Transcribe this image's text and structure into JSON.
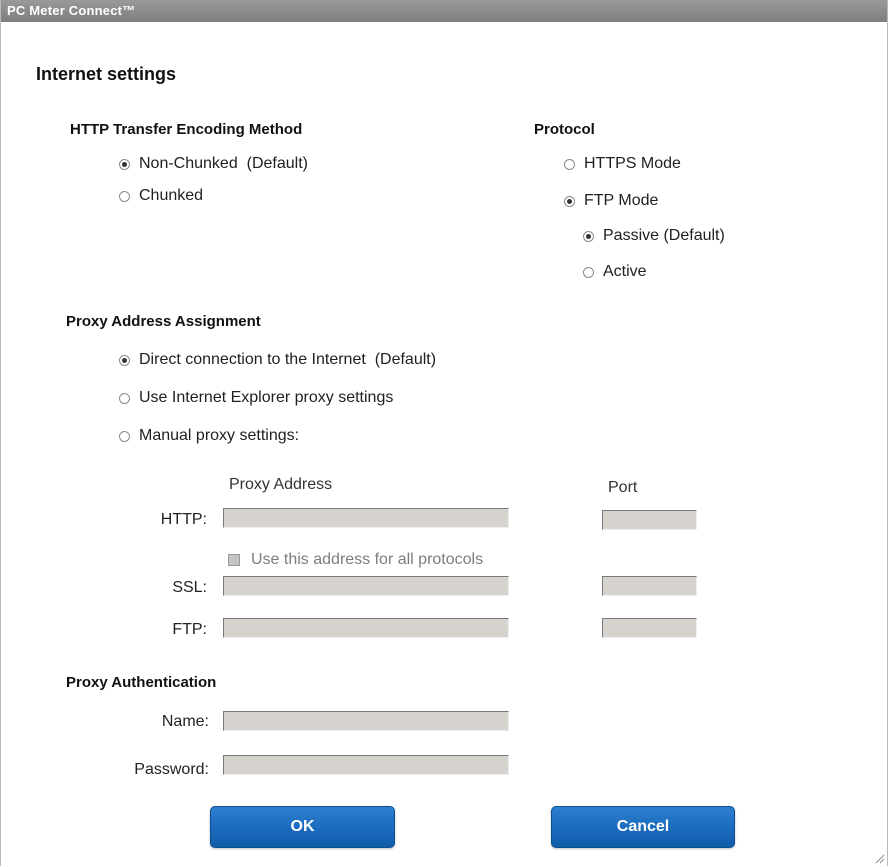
{
  "window": {
    "title": "PC Meter Connect™"
  },
  "page_title": "Internet settings",
  "encoding": {
    "heading": "HTTP Transfer Encoding Method",
    "options": [
      {
        "label": "Non-Chunked  (Default)",
        "checked": true
      },
      {
        "label": "Chunked",
        "checked": false
      }
    ]
  },
  "protocol": {
    "heading": "Protocol",
    "options": [
      {
        "label": "HTTPS Mode",
        "checked": false
      },
      {
        "label": "FTP Mode",
        "checked": true
      }
    ],
    "ftp_sub_options": [
      {
        "label": "Passive (Default)",
        "checked": true
      },
      {
        "label": "Active",
        "checked": false
      }
    ]
  },
  "proxy": {
    "heading": "Proxy Address Assignment",
    "options": [
      {
        "label": "Direct connection to the Internet  (Default)",
        "checked": true
      },
      {
        "label": "Use Internet Explorer proxy settings",
        "checked": false
      },
      {
        "label": "Manual proxy settings:",
        "checked": false
      }
    ],
    "address_header": "Proxy Address",
    "port_header": "Port",
    "http_label": "HTTP:",
    "ssl_label": "SSL:",
    "ftp_label": "FTP:",
    "http_address": "",
    "http_port": "",
    "ssl_address": "",
    "ssl_port": "",
    "ftp_address": "",
    "ftp_port": "",
    "same_for_all_label": "Use this address for all protocols",
    "same_for_all_checked": false
  },
  "auth": {
    "heading": "Proxy Authentication",
    "name_label": "Name:",
    "password_label": "Password:",
    "name_value": "",
    "password_value": ""
  },
  "buttons": {
    "ok": "OK",
    "cancel": "Cancel"
  },
  "colors": {
    "title_bar": "#8e8e8e",
    "field_disabled": "#d6d3ce",
    "button_blue": "#1c6cbf"
  }
}
